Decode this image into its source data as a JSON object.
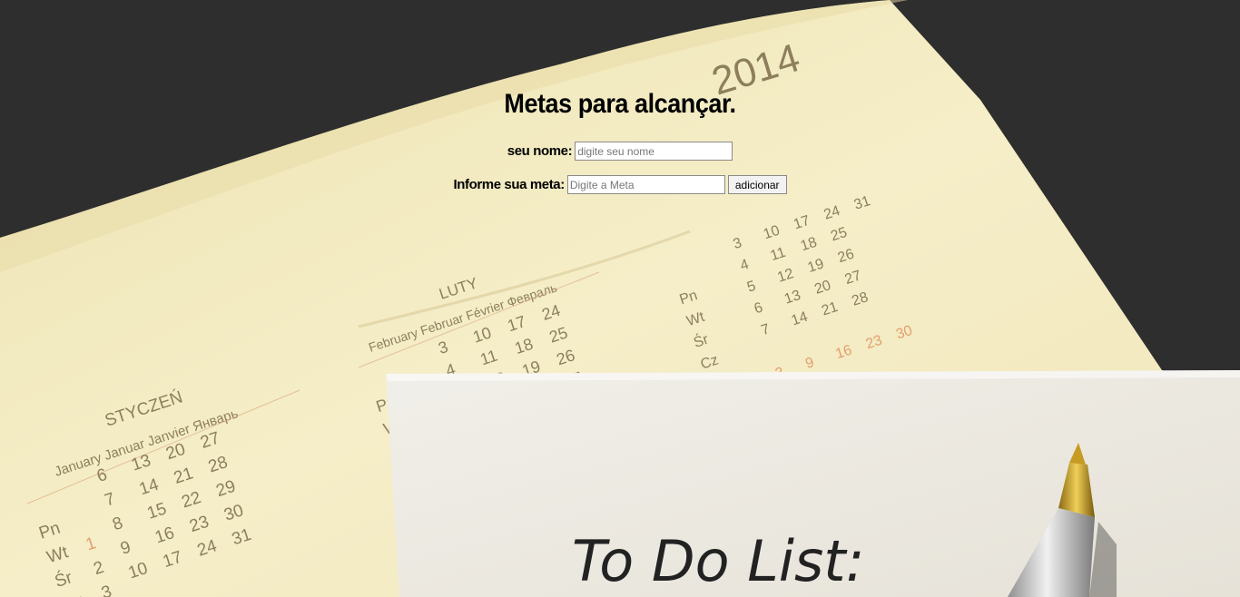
{
  "header": {
    "title": "Metas para alcançar."
  },
  "form": {
    "name_label": "seu nome:",
    "name_placeholder": "digite seu nome",
    "name_value": "",
    "goal_label": "Informe sua meta:",
    "goal_placeholder": "Digite a Meta",
    "goal_value": "",
    "add_button": "adicionar"
  },
  "background": {
    "year": "2014",
    "month_left": "STYCZEŃ",
    "month_left_sub": "January Januar Janvier Январь",
    "month_mid": "LUTY",
    "month_mid_sub": "February Februar Février Февраль",
    "todo_note": "To Do List:"
  },
  "colors": {
    "desk": "#2e2e2e",
    "calendar_paper": "#f3ebc2",
    "note_paper": "#efece4",
    "accent_red": "#d9622b"
  }
}
